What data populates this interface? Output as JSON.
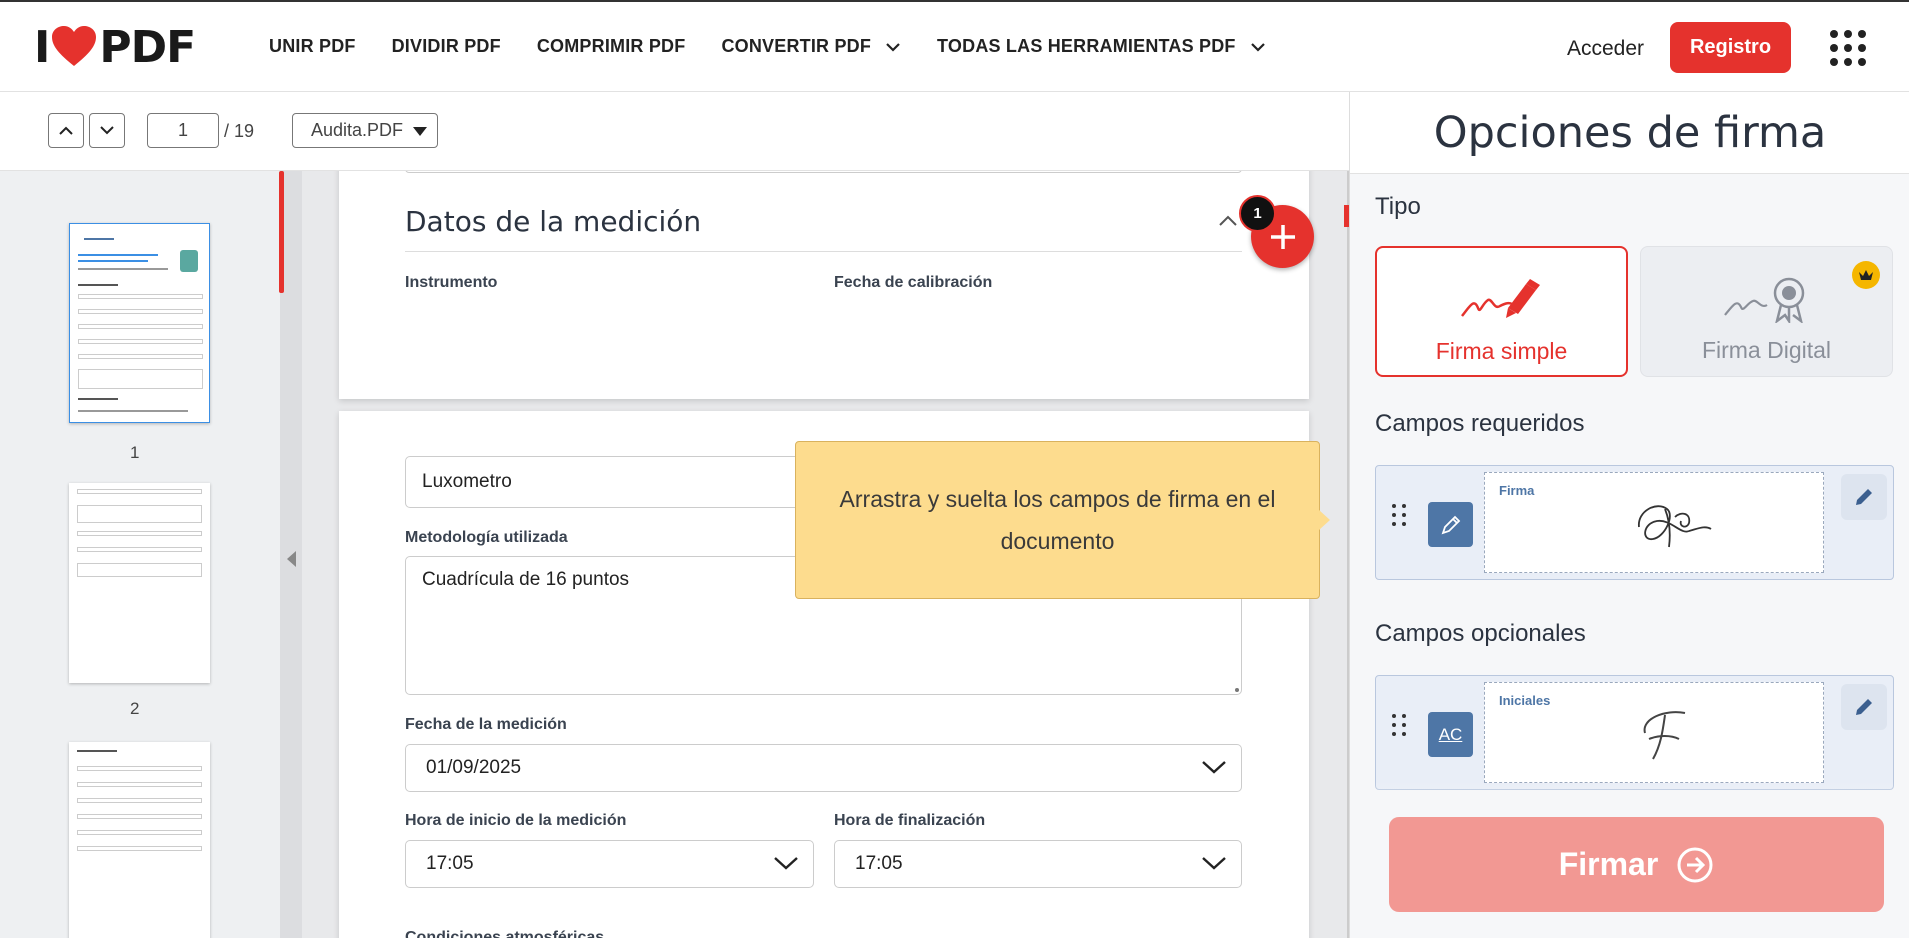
{
  "header": {
    "logo_left": "I",
    "logo_right": "PDF",
    "nav": [
      "UNIR PDF",
      "DIVIDIR PDF",
      "COMPRIMIR PDF",
      "CONVERTIR PDF",
      "TODAS LAS HERRAMIENTAS PDF"
    ],
    "login": "Acceder",
    "register": "Registro"
  },
  "toolbar": {
    "current_page": "1",
    "total_pages": "/ 19",
    "file_name": "Audita.PDF"
  },
  "thumbnails": {
    "labels": [
      "1",
      "2"
    ]
  },
  "document": {
    "section_title": "Datos de la medición",
    "instrument_label": "Instrumento",
    "calibration_label": "Fecha de calibración",
    "instrument_value": "Luxometro",
    "method_label": "Metodología utilizada",
    "method_value": "Cuadrícula de 16 puntos",
    "date_label": "Fecha de la medición",
    "date_value": "01/09/2025",
    "start_label": "Hora de inicio de la medición",
    "start_value": "17:05",
    "end_label": "Hora de finalización",
    "end_value": "17:05",
    "next_label": "Condiciones atmosféricas"
  },
  "tooltip": {
    "text": "Arrastra y suelta los campos de firma en el documento"
  },
  "add_badge": "1",
  "panel": {
    "title": "Opciones de firma",
    "type_label": "Tipo",
    "simple": "Firma simple",
    "digital": "Firma Digital",
    "required_label": "Campos requeridos",
    "signature_caption": "Firma",
    "optional_label": "Campos opcionales",
    "initials_caption": "Iniciales",
    "initials_icon_text": "AC",
    "sign_button": "Firmar"
  },
  "colors": {
    "brand": "#e5322d",
    "tooltip": "#fddc8e",
    "field_icon": "#4e76a6"
  }
}
